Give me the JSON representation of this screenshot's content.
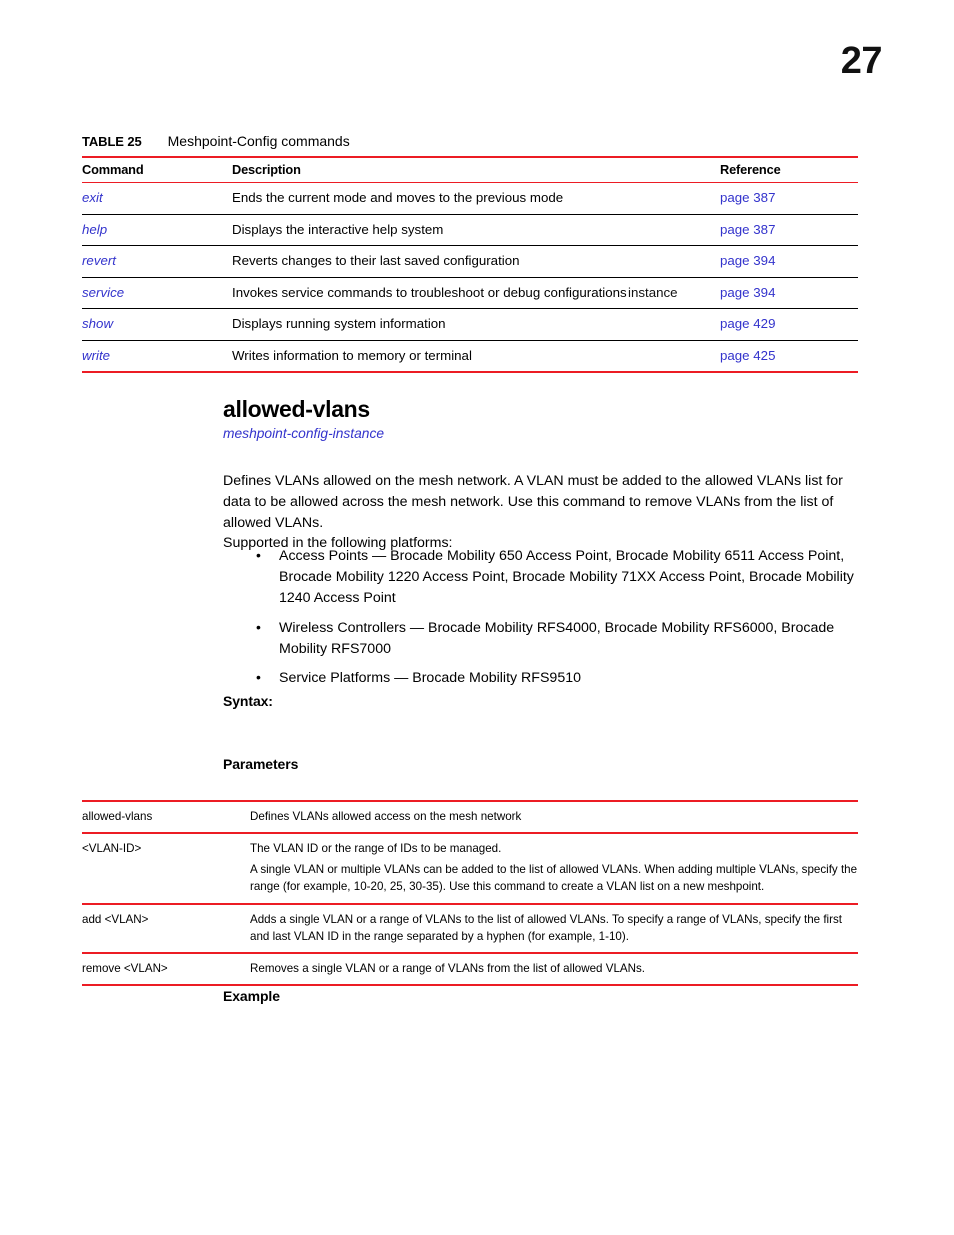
{
  "folio": {
    "page_number": "27"
  },
  "table25": {
    "caption_label": "TABLE 25",
    "caption_title": "Meshpoint-Config commands",
    "columns": [
      "Command",
      "Description",
      "",
      "Reference"
    ],
    "rows": [
      {
        "command": "exit",
        "description": "Ends the current mode and moves to the previous mode",
        "extra": "",
        "reference": "page 387"
      },
      {
        "command": "help",
        "description": "Displays the interactive help system",
        "extra": "",
        "reference": "page 387"
      },
      {
        "command": "revert",
        "description": "Reverts changes to their last saved configuration",
        "extra": "",
        "reference": "page 394"
      },
      {
        "command": "service",
        "description": "Invokes service commands to troubleshoot or debug configurations",
        "extra": "instance",
        "reference": "page 394"
      },
      {
        "command": "show",
        "description": "Displays running system information",
        "extra": "",
        "reference": "page 429"
      },
      {
        "command": "write",
        "description": "Writes information to memory or terminal",
        "extra": "",
        "reference": "page 425"
      }
    ]
  },
  "command_section": {
    "title": "allowed-vlans",
    "mode_link": "meshpoint-config-instance",
    "description_1": "Defines VLANs allowed on the mesh network. A VLAN must be added to the allowed VLANs list for data to be allowed across the mesh network. Use this command to remove VLANs from the list of allowed VLANs.",
    "description_2": "Supported in the following platforms:",
    "platforms": [
      "Access Points — Brocade Mobility 650 Access Point, Brocade Mobility 6511 Access Point, Brocade Mobility 1220 Access Point, Brocade Mobility 71XX Access Point, Brocade Mobility 1240 Access Point",
      "Wireless Controllers — Brocade Mobility RFS4000, Brocade Mobility RFS6000, Brocade Mobility RFS7000",
      "Service Platforms — Brocade Mobility RFS9510"
    ],
    "syntax_heading": "Syntax:",
    "syntax_text": "",
    "parameters_heading": "Parameters",
    "example_heading": "Example"
  },
  "parameters_table": {
    "rows": [
      {
        "name": "allowed-vlans",
        "lines": [
          "Defines VLANs allowed access on the mesh network"
        ]
      },
      {
        "name": "<VLAN-ID>",
        "lines": [
          "The VLAN ID or the range of IDs to be managed.",
          "A single VLAN or multiple VLANs can be added to the list of allowed VLANs. When adding multiple VLANs, specify the range (for example, 10-20, 25, 30-35). Use this command to create a VLAN list on a new meshpoint."
        ]
      },
      {
        "name": "add <VLAN>",
        "lines": [
          "Adds a single VLAN or a range of VLANs to the list of allowed VLANs. To specify a range of VLANs, specify the first and last VLAN ID in the range separated by a hyphen (for example, 1-10)."
        ]
      },
      {
        "name": "remove <VLAN>",
        "lines": [
          "Removes a single VLAN or a range of VLANs from the list of allowed VLANs."
        ]
      }
    ]
  },
  "colors": {
    "rule_red": "#EC1C24",
    "link_blue": "#3333CC",
    "text_black": "#000000"
  }
}
